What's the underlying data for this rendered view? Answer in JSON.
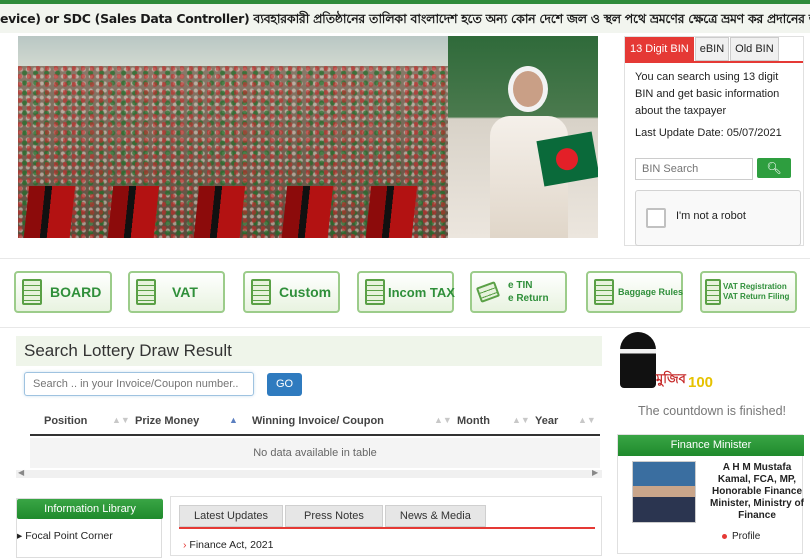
{
  "ticker": {
    "text": "evice) or SDC (Sales Data Controller) ব্যবহারকারী প্রতিষ্ঠানের তালিকা        বাংলাদেশ হতে অন্য কোন দেশে জল ও স্থল পথে ভ্রমণের ক্ষেত্রে ভ্রমণ কর প্রদানের জন্য এখানে ক্লিক কর"
  },
  "bin": {
    "tabs": [
      "13 Digit BIN",
      "eBIN",
      "Old BIN"
    ],
    "description": "You can search using 13 digit BIN and get basic information about the taxpayer",
    "last_update": "Last Update Date: 05/07/2021",
    "search_placeholder": "BIN Search",
    "search_icon": "search-icon",
    "captcha_label": "I'm not a robot"
  },
  "services": [
    {
      "label": "BOARD"
    },
    {
      "label": "VAT"
    },
    {
      "label": "Custom"
    },
    {
      "label": "Incom TAX"
    },
    {
      "label": "e TIN\ne Return"
    },
    {
      "label": "Baggage Rules"
    },
    {
      "label": "VAT Registration\nVAT Return Filing"
    }
  ],
  "lottery": {
    "title": "Search Lottery Draw Result",
    "placeholder": "Search .. in your Invoice/Coupon number..",
    "go": "GO",
    "columns": [
      "Position",
      "Prize Money",
      "Winning Invoice/ Coupon",
      "Month",
      "Year"
    ],
    "empty": "No data available in table"
  },
  "info_library": {
    "title": "Information Library",
    "items": [
      "Focal Point Corner"
    ]
  },
  "updates": {
    "tabs": [
      "Latest Updates",
      "Press Notes",
      "News & Media"
    ],
    "items": [
      "Finance Act, 2021"
    ]
  },
  "mujib": {
    "text": "মুজিব",
    "number": "100"
  },
  "countdown": "The countdown is finished!",
  "finance_minister": {
    "title": "Finance Minister",
    "name": "A H M Mustafa Kamal, FCA, MP, Honorable Finance Minister, Ministry of Finance",
    "links": [
      "Profile"
    ]
  },
  "colors": {
    "accent_red": "#e53935",
    "accent_green": "#2e9e3f"
  }
}
